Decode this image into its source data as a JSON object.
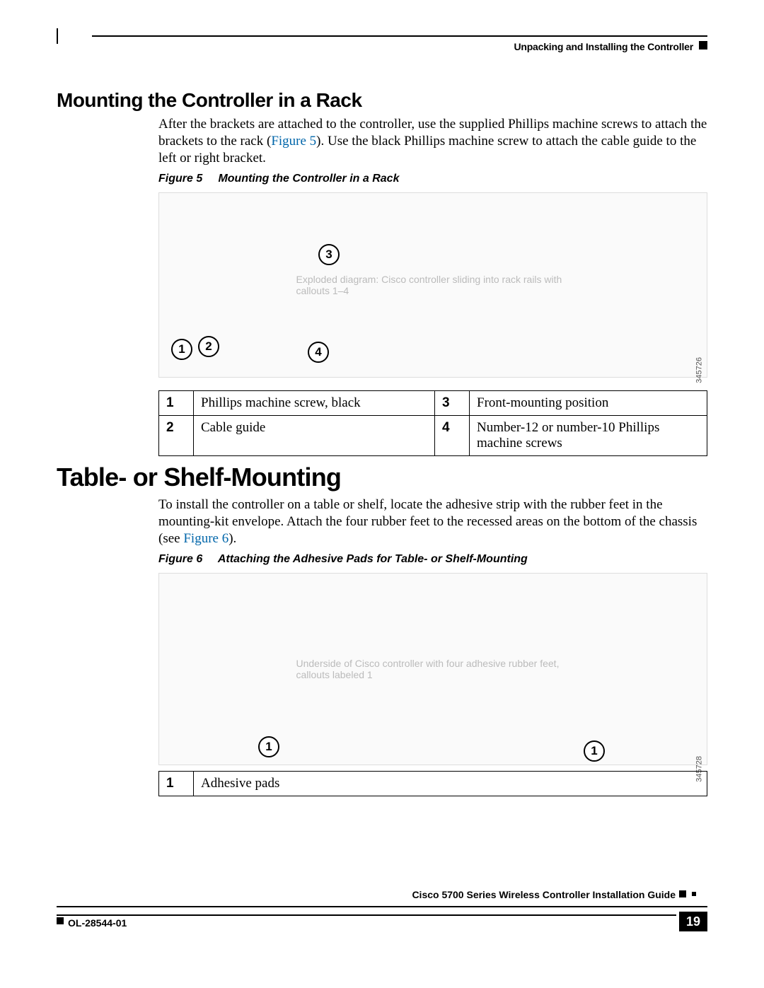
{
  "header": {
    "chapter": "Unpacking and Installing the Controller"
  },
  "section1": {
    "heading": "Mounting the Controller in a Rack",
    "para_a": "After the brackets are attached to the controller, use the supplied Phillips machine screws to attach the brackets to the rack (",
    "figref": "Figure 5",
    "para_b": "). Use the black Phillips machine screw to attach the cable guide to the left or right bracket."
  },
  "figure5": {
    "label": "Figure 5",
    "caption": "Mounting the Controller in a Rack",
    "image_alt": "Exploded diagram: Cisco controller sliding into rack rails with callouts 1–4",
    "drawing_id": "345726",
    "callouts": {
      "c1": "1",
      "c2": "2",
      "c3": "3",
      "c4": "4"
    },
    "table": {
      "n1": "1",
      "t1": "Phillips machine screw, black",
      "n3": "3",
      "t3": "Front-mounting position",
      "n2": "2",
      "t2": "Cable guide",
      "n4": "4",
      "t4": "Number-12 or number-10 Phillips machine screws"
    }
  },
  "section2": {
    "heading": "Table- or Shelf-Mounting",
    "para_a": "To install the controller on a table or shelf, locate the adhesive strip with the rubber feet in the mounting-kit envelope. Attach the four rubber feet to the recessed areas on the bottom of the chassis (see ",
    "figref": "Figure 6",
    "para_b": ")."
  },
  "figure6": {
    "label": "Figure 6",
    "caption": "Attaching the Adhesive Pads for Table- or Shelf-Mounting",
    "image_alt": "Underside of Cisco controller with four adhesive rubber feet, callouts labeled 1",
    "drawing_id": "345728",
    "callouts": {
      "c1": "1",
      "c1b": "1"
    },
    "table": {
      "n1": "1",
      "t1": "Adhesive pads"
    }
  },
  "footer": {
    "guide": "Cisco 5700 Series Wireless Controller Installation Guide",
    "doc_id": "OL-28544-01",
    "page": "19"
  }
}
